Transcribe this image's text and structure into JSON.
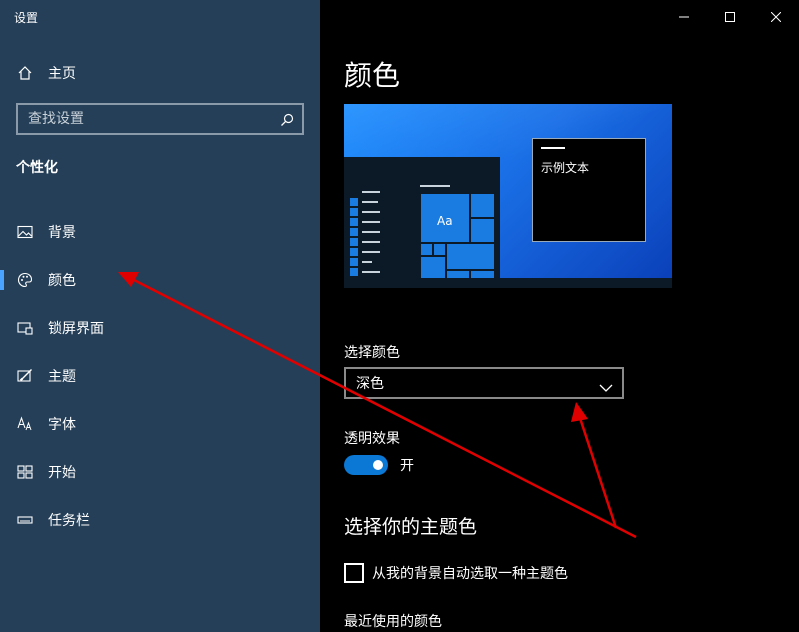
{
  "window": {
    "title": "设置",
    "controls": [
      "minimize-icon",
      "maximize-icon",
      "close-icon"
    ]
  },
  "sidebar": {
    "home_label": "主页",
    "search_placeholder": "查找设置",
    "section_title": "个性化",
    "items": [
      {
        "label": "背景",
        "icon": "picture-icon",
        "active": false
      },
      {
        "label": "颜色",
        "icon": "palette-icon",
        "active": true
      },
      {
        "label": "锁屏界面",
        "icon": "lock-screen-icon",
        "active": false
      },
      {
        "label": "主题",
        "icon": "theme-brush-icon",
        "active": false
      },
      {
        "label": "字体",
        "icon": "font-icon",
        "active": false
      },
      {
        "label": "开始",
        "icon": "start-grid-icon",
        "active": false
      },
      {
        "label": "任务栏",
        "icon": "taskbar-icon",
        "active": false
      }
    ]
  },
  "main": {
    "title": "颜色",
    "preview": {
      "tile_label": "Aa",
      "sample_text": "示例文本"
    },
    "choose_color_label": "选择颜色",
    "choose_color_value": "深色",
    "transparency_label": "透明效果",
    "transparency_state": "开",
    "transparency_on": true,
    "accent_title": "选择你的主题色",
    "auto_accent_label": "从我的背景自动选取一种主题色",
    "auto_accent_checked": false,
    "recent_colors_label": "最近使用的颜色"
  },
  "colors": {
    "sidebar_bg": "#243f57",
    "accent": "#0a78d4",
    "annotation_arrow": "#e00000"
  }
}
